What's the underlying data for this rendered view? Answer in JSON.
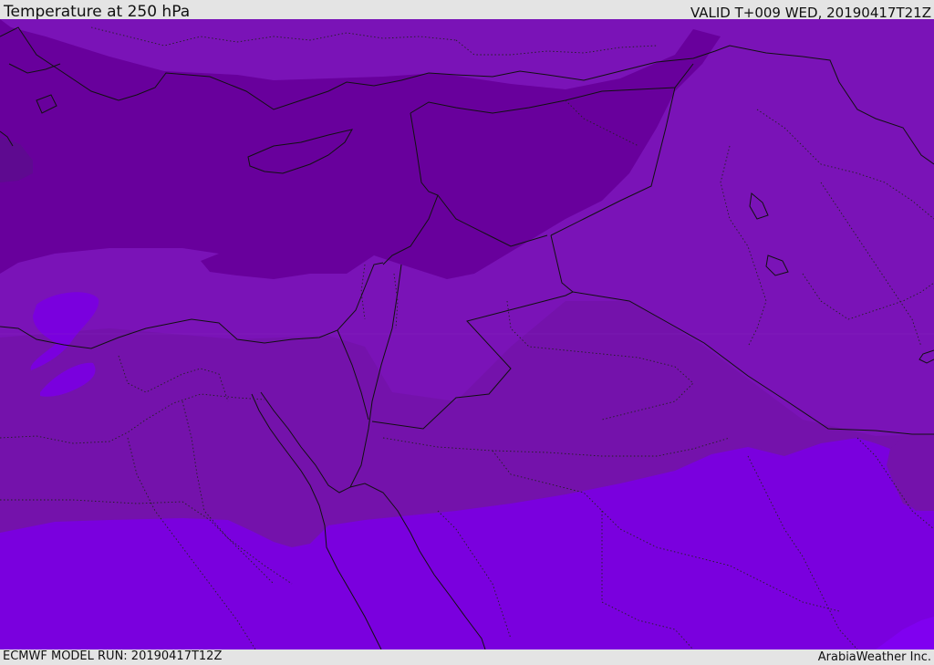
{
  "header": {
    "title": "Temperature at 250 hPa",
    "valid_time": "VALID T+009 WED, 20190417T21Z"
  },
  "footer": {
    "model_run": "ECMWF MODEL RUN: 20190417T12Z",
    "credit": "ArabiaWeather Inc."
  },
  "map": {
    "colors": {
      "base": "#7a13b7",
      "darkest": "#5e0a90",
      "dark": "#68009c",
      "mid": "#7412ab",
      "bright": "#7a00de",
      "brightest": "#8000f0",
      "border": "#111111"
    }
  }
}
